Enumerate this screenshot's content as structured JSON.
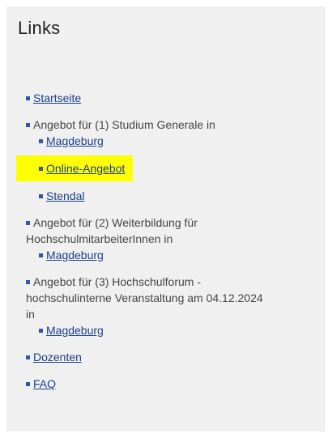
{
  "box": {
    "title": "Links"
  },
  "nav": {
    "startseite": "Startseite",
    "group1": {
      "label": "Angebot für (1) Studium Generale in",
      "items": [
        "Magdeburg",
        "Online-Angebot",
        "Stendal"
      ]
    },
    "group2": {
      "label_line1": "Angebot für (2) Weiterbildung für",
      "label_line2": "HochschulmitarbeiterInnen in",
      "items": [
        "Magdeburg"
      ]
    },
    "group3": {
      "label_line1": "Angebot für (3) Hochschulforum -",
      "label_line2": "hochschulinterne Veranstaltung am 04.12.2024",
      "label_line3": "in",
      "items": [
        "Magdeburg"
      ]
    },
    "dozenten": "Dozenten",
    "faq": "FAQ"
  },
  "colors": {
    "highlight": "#ffff00",
    "link": "#1a3e8c",
    "bullet": "#3355aa",
    "panel": "#f0f0f0"
  }
}
